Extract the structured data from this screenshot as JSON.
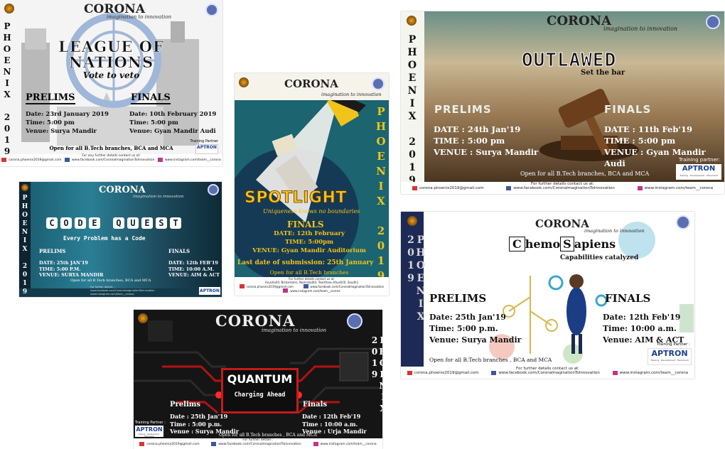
{
  "brand": "CORONA",
  "tagline": "imagination to innovation",
  "fest": "PHOENIX 2019",
  "training_partner_label": "Training Partner",
  "training_partner_label_colon": "Training Partner :",
  "training_partner_label_alt": "Training partner:",
  "aptron": "APTRON",
  "aptron_sub": "Training · Development · Placement",
  "contact_label": "For any further details contact us at:",
  "contact_label_short": "For further details contact us at:",
  "contact_label_min": "For further details :",
  "email": "corona.phoenix2019@gmail.com",
  "facebook": "www.facebook.com/CoronaImaginationToInnovation",
  "instagram": "www.instagram.com/team__corona",
  "league": {
    "title_1": "LEAGUE OF",
    "title_2": "NATIONS",
    "subtitle": "Vote to veto",
    "prelims_label": "PRELIMS",
    "finals_label": "FINALS",
    "prelims_date": "Date: 23rd January 2019",
    "prelims_time": "Time: 5:00 pm",
    "prelims_venue": "Venue: Surya Mandir",
    "finals_date": "Date: 10th February 2019",
    "finals_time": "Time: 5:00 pm",
    "finals_venue": "Venue: Gyan Mandir Audi",
    "open": "Open for all B.Tech branches, BCA and MCA"
  },
  "outlawed": {
    "title": "OUTLAWED",
    "subtitle": "Set the bar",
    "prelims_label": "PRELIMS",
    "finals_label": "FINALS",
    "prelims_date": "DATE : 24th Jan'19",
    "prelims_time": "TIME : 5:00 pm",
    "prelims_venue": "VENUE : Surya Mandir",
    "finals_date": "DATE : 11th Feb'19",
    "finals_time": "TIME : 5:00 pm",
    "finals_venue": "VENUE : Gyan Mandir Audi",
    "open": "Open for all B.Tech branches,  BCA and MCA"
  },
  "spotlight": {
    "title": "SPOTLIGHT",
    "subtitle": "Uniqueness knows no boundaries",
    "finals_label": "FINALS",
    "date": "DATE: 12th February",
    "time": "TIME: 5:00pm",
    "venue": "VENUE: Gyan Mandir Auditorium",
    "submission": "Last date of submission: 25th January",
    "open": "Open for all B.Tech branches",
    "contacts": "Anusha(III, Nishantam), Namrata(III), Tearthanu Khushi(II, Saudhi)"
  },
  "codequest": {
    "title_letters": [
      "C",
      "O",
      "D",
      "E",
      "Q",
      "U",
      "E",
      "S",
      "T"
    ],
    "subtitle": "Every Problem has a Code",
    "prelims_label": "PRELIMS",
    "finals_label": "FINALS",
    "prelims_date": "DATE: 25th JAN'19",
    "prelims_time": "TIME: 5:00 P.M.",
    "prelims_venue": "VENUE: SURYA MANDIR",
    "finals_date": "DATE: 12th FEB'19",
    "finals_time": "TIME: 10:00 A.M.",
    "finals_venue": "VENUE: AIM & ACT",
    "open": "Open for all B.Tech branches, BCA and MCA"
  },
  "chemosapiens": {
    "title_c": "C",
    "title_mid": "hemo",
    "title_s": "S",
    "title_end": "apiens",
    "subtitle": "Capabilities catalyzed",
    "prelims_label": "PRELIMS",
    "finals_label": "FINALS",
    "prelims_date": "Date: 25th Jan'19",
    "prelims_time": "Time: 5:00 p.m.",
    "prelims_venue": "Venue: Surya Mandir",
    "finals_date": "Date: 12th Feb'19",
    "finals_time": "Time: 10:00 a.m.",
    "finals_venue": "Venue: AIM & ACT",
    "open": "Open for all B.Tech branches , BCA and MCA"
  },
  "quantum": {
    "title": "QUANTUM",
    "subtitle": "Charging Ahead",
    "prelims_label": "Prelims",
    "finals_label": "Finals",
    "prelims_date": "Date : 25th Jan'19",
    "prelims_time": "Time : 5:00 p.m.",
    "prelims_venue": "Venue : Surya Mandir",
    "finals_date": "Date : 12th Feb'19",
    "finals_time": "Time : 10:00 a.m.",
    "finals_venue": "Venue : Urja Mandir",
    "open": "Open for all B.Tech branches , BCA and MCA"
  },
  "colors": {
    "gold": "#f0c419",
    "teal": "#1f6f7a",
    "navy": "#1b2a57",
    "red": "#d62020",
    "purple": "#5b2b8c"
  }
}
